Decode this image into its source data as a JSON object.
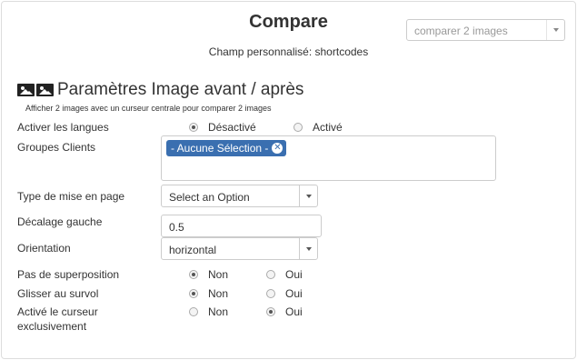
{
  "header": {
    "title": "Compare",
    "subtitle": "Champ personnalisé: shortcodes",
    "shortcode_select": {
      "placeholder": "comparer 2 images"
    }
  },
  "section": {
    "title": "Paramètres Image avant / après",
    "description": "Afficher 2 images avec un curseur centrale pour comparer 2 images",
    "icons": [
      "image-icon",
      "image-icon"
    ]
  },
  "fields": {
    "langues": {
      "label": "Activer les langues",
      "options": [
        "Désactivé",
        "Activé"
      ],
      "selected": "Désactivé"
    },
    "groupes_clients": {
      "label": "Groupes Clients",
      "tag": "- Aucune Sélection -"
    },
    "type_mise_en_page": {
      "label": "Type de mise en page",
      "value": "Select an Option"
    },
    "decalage_gauche": {
      "label": "Décalage gauche",
      "value": "0.5"
    },
    "orientation": {
      "label": "Orientation",
      "value": "horizontal"
    },
    "pas_de_superposition": {
      "label": "Pas de superposition",
      "options": [
        "Non",
        "Oui"
      ],
      "selected": "Non"
    },
    "glisser_au_survol": {
      "label": "Glisser au survol",
      "options": [
        "Non",
        "Oui"
      ],
      "selected": "Non"
    },
    "curseur_exclusif": {
      "label_line1": "Activé le curseur",
      "label_line2": "exclusivement",
      "options": [
        "Non",
        "Oui"
      ],
      "selected": "Oui"
    }
  },
  "colors": {
    "tag_background": "#3a6fb0",
    "border": "#cccccc",
    "text": "#333333"
  }
}
